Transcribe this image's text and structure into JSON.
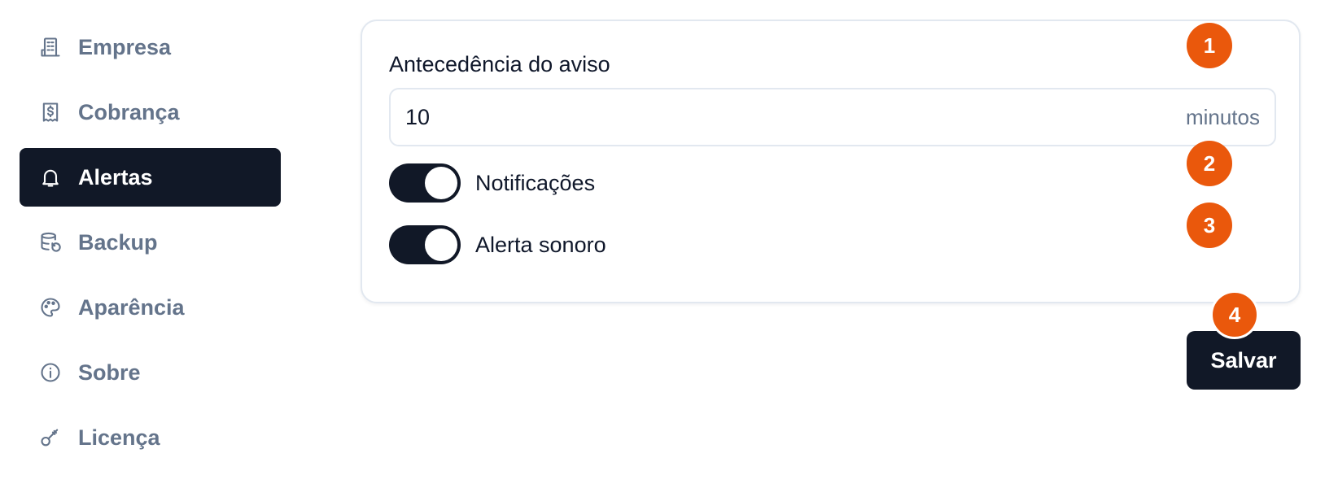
{
  "sidebar": {
    "items": [
      {
        "label": "Empresa",
        "icon": "building-icon"
      },
      {
        "label": "Cobrança",
        "icon": "receipt-icon"
      },
      {
        "label": "Alertas",
        "icon": "bell-icon",
        "active": true
      },
      {
        "label": "Backup",
        "icon": "database-restore-icon"
      },
      {
        "label": "Aparência",
        "icon": "palette-icon"
      },
      {
        "label": "Sobre",
        "icon": "info-icon"
      },
      {
        "label": "Licença",
        "icon": "key-icon"
      }
    ]
  },
  "card": {
    "advance_label": "Antecedência do aviso",
    "advance_value": "10",
    "advance_unit": "minutos",
    "notifications_label": "Notificações",
    "notifications_on": true,
    "sound_label": "Alerta sonoro",
    "sound_on": true
  },
  "actions": {
    "save_label": "Salvar"
  },
  "badges": [
    "1",
    "2",
    "3",
    "4"
  ],
  "colors": {
    "accent_dark": "#111827",
    "badge_orange": "#ea580c",
    "muted_text": "#64748b"
  }
}
